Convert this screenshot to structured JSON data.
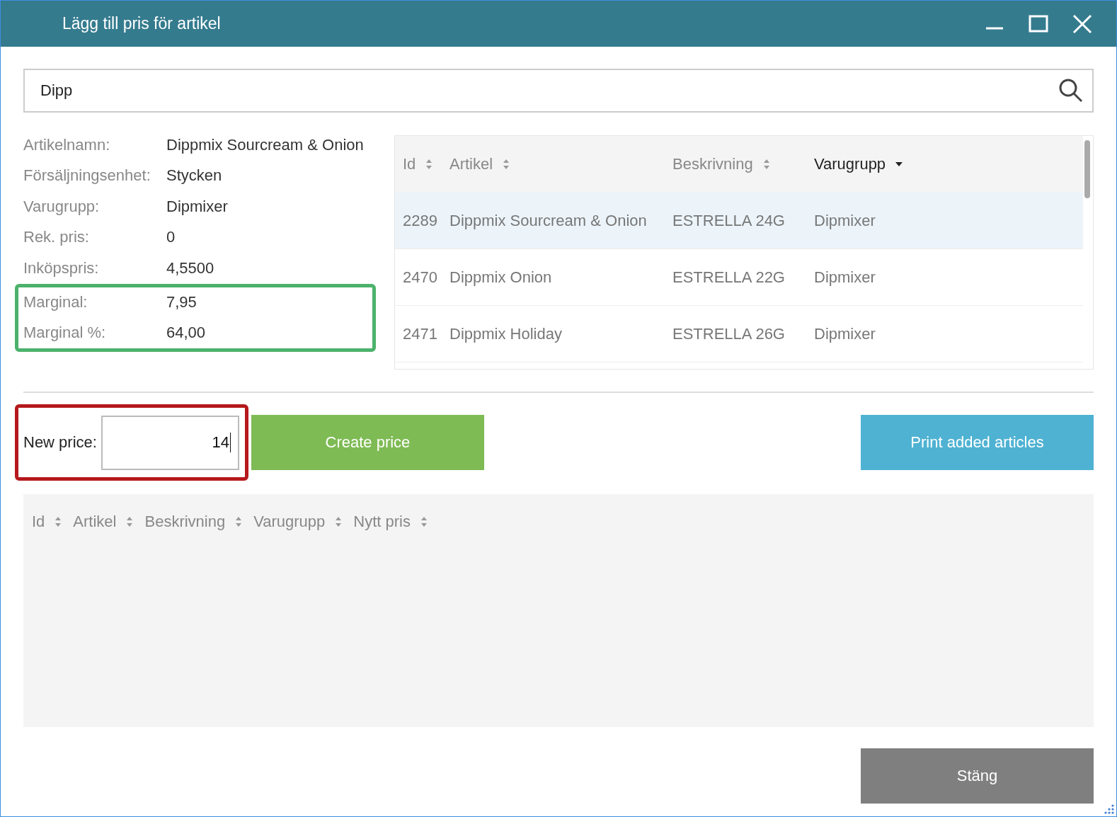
{
  "window": {
    "title": "Lägg till pris för artikel"
  },
  "search": {
    "value": "Dipp"
  },
  "details": {
    "rows": [
      {
        "label": "Artikelnamn:",
        "value": "Dippmix Sourcream & Onion"
      },
      {
        "label": "Försäljningsenhet:",
        "value": "Stycken"
      },
      {
        "label": "Varugrupp:",
        "value": "Dipmixer"
      },
      {
        "label": "Rek. pris:",
        "value": "0"
      },
      {
        "label": "Inköpspris:",
        "value": "4,5500"
      }
    ],
    "highlighted_rows": [
      {
        "label": "Marginal:",
        "value": "7,95"
      },
      {
        "label": "Marginal %:",
        "value": "64,00"
      }
    ],
    "highlight": {
      "color": "#4cb26b"
    }
  },
  "articles_table": {
    "columns": [
      {
        "label": "Id",
        "kind": "sortable"
      },
      {
        "label": "Artikel",
        "kind": "sortable"
      },
      {
        "label": "Beskrivning",
        "kind": "sortable"
      },
      {
        "label": "Varugrupp",
        "kind": "sorted"
      }
    ],
    "rows": [
      {
        "cells": [
          "2289",
          "Dippmix Sourcream & Onion",
          "ESTRELLA 24G",
          "Dipmixer"
        ],
        "selected": true
      },
      {
        "cells": [
          "2470",
          "Dippmix Onion",
          "ESTRELLA 22G",
          "Dipmixer"
        ],
        "selected": false
      },
      {
        "cells": [
          "2471",
          "Dippmix Holiday",
          "ESTRELLA 26G",
          "Dipmixer"
        ],
        "selected": false
      }
    ]
  },
  "price_entry": {
    "label": "New price:",
    "value": "14",
    "highlight": {
      "color": "#b5191c"
    }
  },
  "buttons": {
    "create": "Create price",
    "print": "Print added articles",
    "close": "Stäng"
  },
  "added_table": {
    "columns": [
      {
        "label": "Id",
        "kind": "sortable"
      },
      {
        "label": "Artikel",
        "kind": "sortable"
      },
      {
        "label": "Beskrivning",
        "kind": "sortable"
      },
      {
        "label": "Varugrupp",
        "kind": "sortable"
      },
      {
        "label": "Nytt pris",
        "kind": "sortable"
      }
    ]
  }
}
